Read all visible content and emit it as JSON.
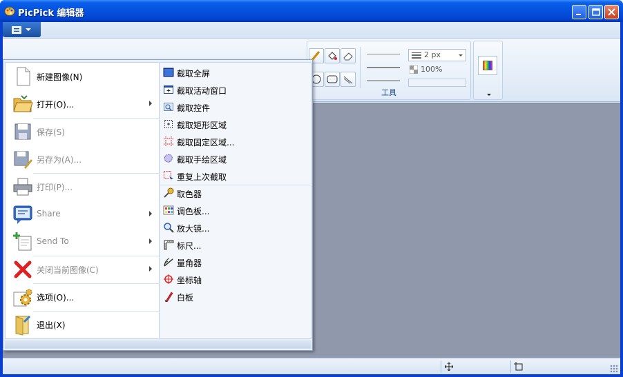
{
  "window": {
    "title": "PicPick 编辑器",
    "colors": {
      "titlebar": "#0553e0",
      "canvas": "#9098ac",
      "ribbon": "#dbe7f5"
    }
  },
  "ribbon": {
    "tools_group_label": "工具",
    "line_width": "2 px",
    "opacity": "100%"
  },
  "menu": {
    "left_items": [
      {
        "label": "新建图像(N)",
        "icon": "new-document-icon",
        "disabled": false,
        "submenu": false
      },
      {
        "label": "打开(O)...",
        "icon": "open-folder-icon",
        "disabled": false,
        "submenu": true
      },
      {
        "label": "保存(S)",
        "icon": "save-disk-icon",
        "disabled": true,
        "submenu": false
      },
      {
        "label": "另存为(A)...",
        "icon": "save-as-icon",
        "disabled": true,
        "submenu": false
      },
      {
        "label": "打印(P)...",
        "icon": "printer-icon",
        "disabled": true,
        "submenu": false
      },
      {
        "label": "Share",
        "icon": "share-icon",
        "disabled": true,
        "submenu": true
      },
      {
        "label": "Send To",
        "icon": "send-to-icon",
        "disabled": true,
        "submenu": true
      },
      {
        "label": "关闭当前图像(C)",
        "icon": "close-x-icon",
        "disabled": true,
        "submenu": true
      },
      {
        "label": "选项(O)...",
        "icon": "options-gears-icon",
        "disabled": false,
        "submenu": false
      },
      {
        "label": "退出(X)",
        "icon": "exit-icon",
        "disabled": false,
        "submenu": false
      }
    ],
    "right_items": [
      {
        "label": "截取全屏",
        "icon": "capture-fullscreen-icon"
      },
      {
        "label": "截取活动窗口",
        "icon": "capture-active-window-icon"
      },
      {
        "label": "截取控件",
        "icon": "capture-control-icon"
      },
      {
        "label": "截取矩形区域",
        "icon": "capture-rectangle-icon"
      },
      {
        "label": "截取固定区域...",
        "icon": "capture-fixed-region-icon"
      },
      {
        "label": "截取手绘区域",
        "icon": "capture-freehand-icon"
      },
      {
        "label": "重复上次截取",
        "icon": "repeat-capture-icon"
      },
      {
        "label": "取色器",
        "icon": "color-picker-icon"
      },
      {
        "label": "调色板...",
        "icon": "palette-icon"
      },
      {
        "label": "放大镜...",
        "icon": "magnifier-icon"
      },
      {
        "label": "标尺...",
        "icon": "ruler-icon"
      },
      {
        "label": "量角器",
        "icon": "protractor-icon"
      },
      {
        "label": "坐标轴",
        "icon": "crosshair-icon"
      },
      {
        "label": "白板",
        "icon": "whiteboard-pen-icon"
      }
    ]
  }
}
